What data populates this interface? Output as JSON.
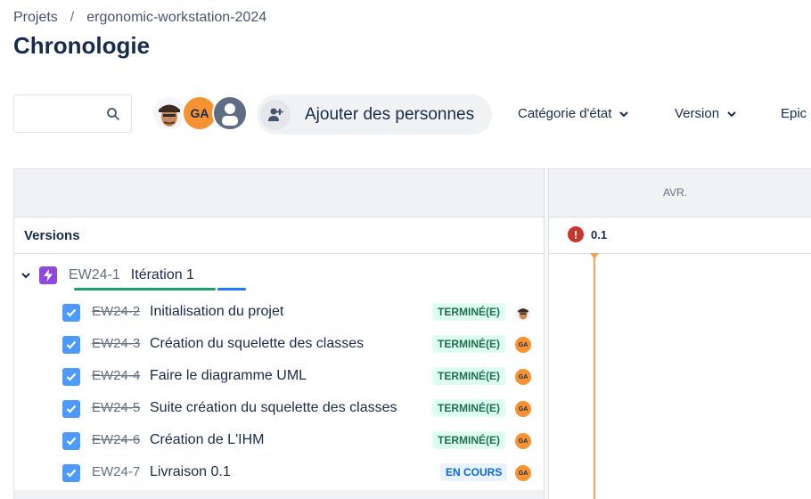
{
  "breadcrumb": {
    "root": "Projets",
    "separator": "/",
    "project": "ergonomic-workstation-2024"
  },
  "page": {
    "title": "Chronologie"
  },
  "toolbar": {
    "search_placeholder": "",
    "avatars": [
      {
        "kind": "photo"
      },
      {
        "initials": "GA"
      },
      {
        "kind": "default-user"
      }
    ],
    "add_people_label": "Ajouter des personnes",
    "filters": [
      {
        "label": "Catégorie d'état"
      },
      {
        "label": "Version"
      },
      {
        "label": "Epic"
      }
    ]
  },
  "timeline": {
    "month": "AVR.",
    "versions_label": "Versions",
    "version_marker": {
      "name": "0.1",
      "icon": "error-icon",
      "color": "#c9372c"
    },
    "today_color": "#f5a259"
  },
  "epic": {
    "key": "EW24-1",
    "title": "Itération 1",
    "icon": "lightning-icon",
    "color": "#8f47e0",
    "progress": {
      "done_fraction": 0.83,
      "in_progress_fraction": 0.17
    }
  },
  "issues": [
    {
      "key": "EW24-2",
      "summary": "Initialisation du projet",
      "status": "TERMINÉ(E)",
      "assignee": "photo"
    },
    {
      "key": "EW24-3",
      "summary": "Création du squelette des classes",
      "status": "TERMINÉ(E)",
      "assignee": "GA"
    },
    {
      "key": "EW24-4",
      "summary": "Faire le diagramme UML",
      "status": "TERMINÉ(E)",
      "assignee": "GA"
    },
    {
      "key": "EW24-5",
      "summary": "Suite création du squelette des classes",
      "status": "TERMINÉ(E)",
      "assignee": "GA"
    },
    {
      "key": "EW24-6",
      "summary": "Création de L'IHM",
      "status": "TERMINÉ(E)",
      "assignee": "GA"
    },
    {
      "key": "EW24-7",
      "summary": "Livraison 0.1",
      "status": "EN COURS",
      "assignee": "GA"
    }
  ]
}
